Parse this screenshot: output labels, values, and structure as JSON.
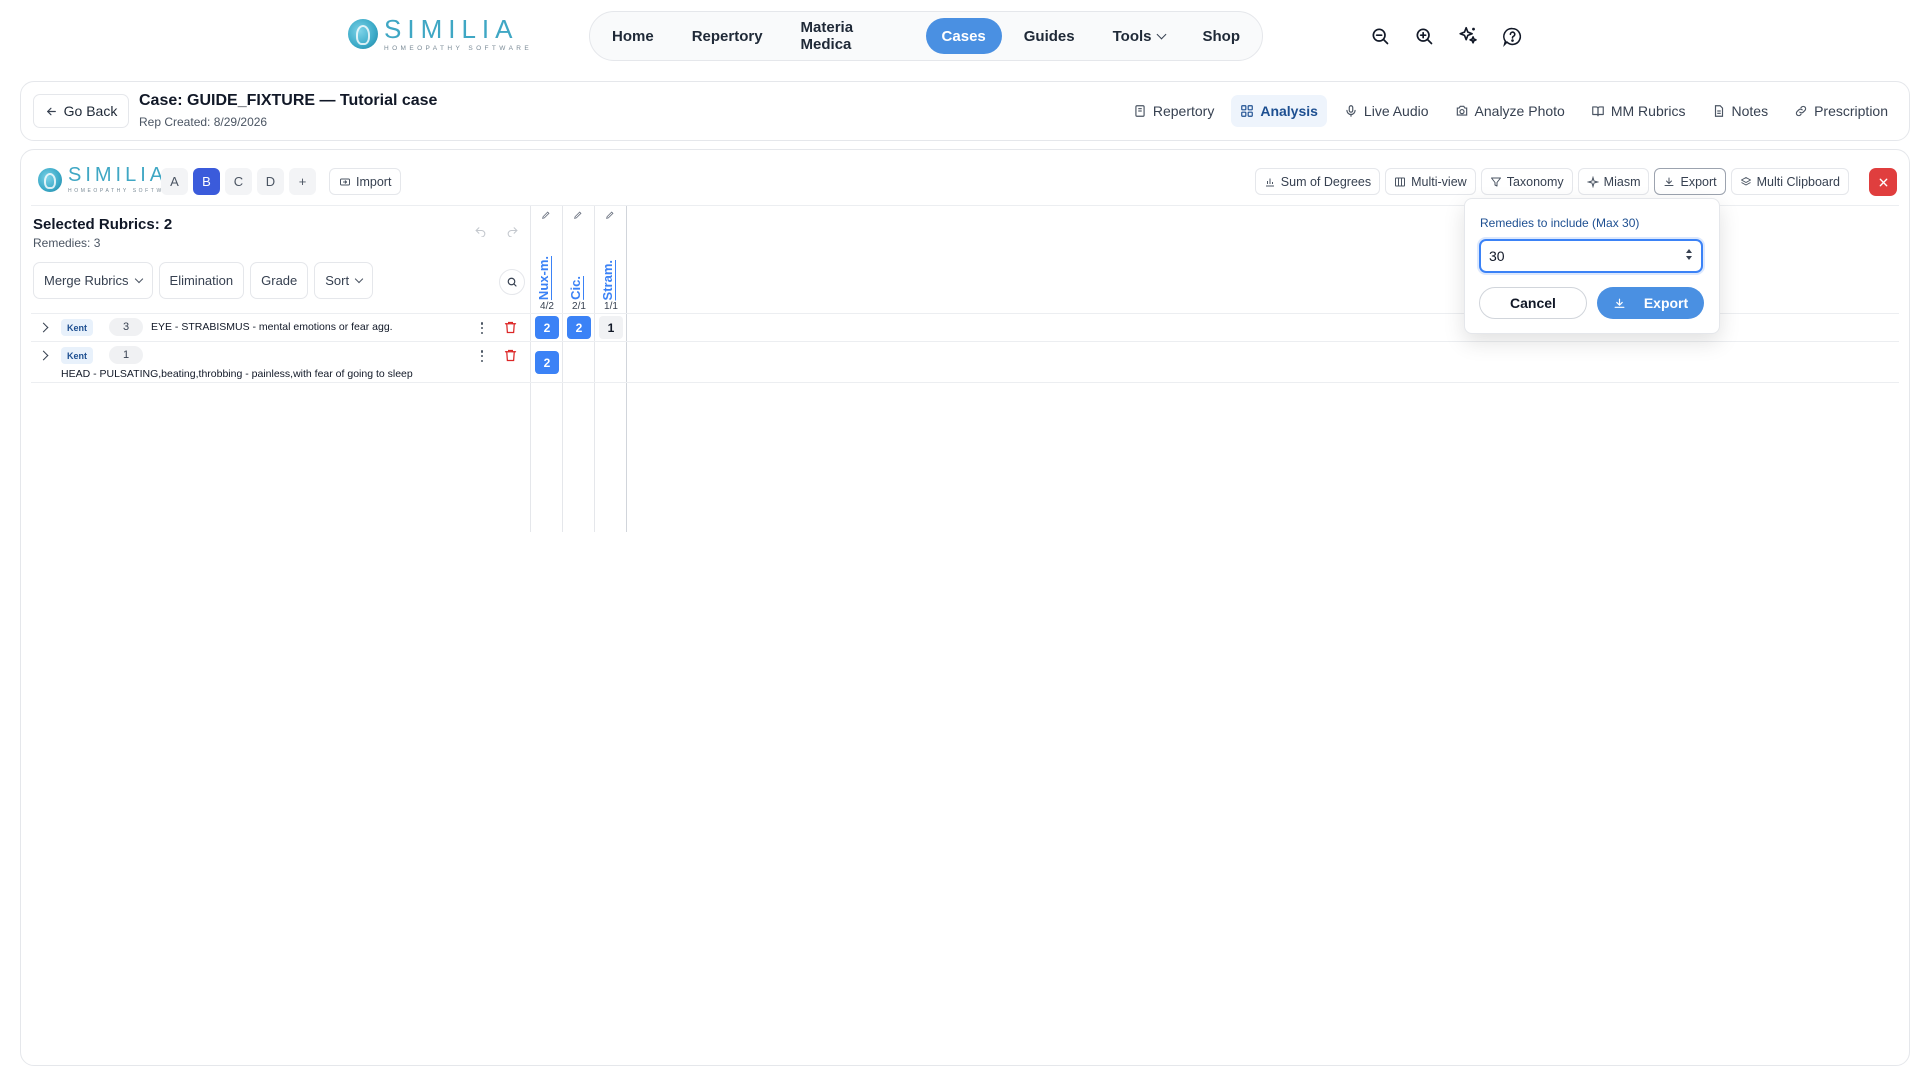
{
  "brand": {
    "name": "SIMILIA",
    "tagline": "HOMEOPATHY SOFTWARE"
  },
  "nav": {
    "items": [
      {
        "label": "Home"
      },
      {
        "label": "Repertory"
      },
      {
        "label": "Materia Medica"
      },
      {
        "label": "Cases",
        "active": true
      },
      {
        "label": "Guides"
      },
      {
        "label": "Tools",
        "dropdown": true
      },
      {
        "label": "Shop"
      }
    ],
    "icons": [
      "zoom-out-icon",
      "zoom-in-icon",
      "sparkles-icon",
      "help-icon"
    ]
  },
  "case": {
    "back_label": "Go Back",
    "title": "Case: GUIDE_FIXTURE — Tutorial case",
    "subtitle": "Rep Created: 8/29/2026",
    "tabs": [
      {
        "label": "Repertory",
        "icon": "book-icon"
      },
      {
        "label": "Analysis",
        "icon": "grid-icon",
        "active": true
      },
      {
        "label": "Live Audio",
        "icon": "mic-icon"
      },
      {
        "label": "Analyze Photo",
        "icon": "camera-icon"
      },
      {
        "label": "MM Rubrics",
        "icon": "open-book-icon"
      },
      {
        "label": "Notes",
        "icon": "note-icon"
      },
      {
        "label": "Prescription",
        "icon": "link-icon"
      }
    ]
  },
  "workspace": {
    "rep_tabs": [
      "A",
      "B",
      "C",
      "D",
      "+"
    ],
    "active_tab": "B",
    "import_label": "Import",
    "toolbar": [
      {
        "label": "Sum of Degrees",
        "icon": "bar-chart-icon"
      },
      {
        "label": "Multi-view",
        "icon": "columns-icon"
      },
      {
        "label": "Taxonomy",
        "icon": "filter-icon"
      },
      {
        "label": "Miasm",
        "icon": "sparkle-icon"
      },
      {
        "label": "Export",
        "icon": "download-icon"
      },
      {
        "label": "Multi Clipboard",
        "icon": "layers-icon"
      }
    ],
    "selected_rubrics": "Selected Rubrics: 2",
    "remedies_count": "Remedies: 3",
    "filters": {
      "merge": "Merge Rubrics",
      "elimination": "Elimination",
      "grade": "Grade",
      "sort": "Sort"
    },
    "remedies": [
      {
        "name": "Nux-m.",
        "ratio": "4/2"
      },
      {
        "name": "Cic.",
        "ratio": "2/1"
      },
      {
        "name": "Stram.",
        "ratio": "1/1"
      }
    ],
    "rubrics": [
      {
        "source": "Kent",
        "grade": "3",
        "text": "EYE - STRABISMUS - mental emotions or fear agg.",
        "cells": [
          "2",
          "2",
          "1"
        ]
      },
      {
        "source": "Kent",
        "grade": "1",
        "text": "HEAD - PULSATING,beating,throbbing - painless,with fear of going to sleep",
        "cells": [
          "2",
          "",
          ""
        ]
      }
    ]
  },
  "export_popover": {
    "label": "Remedies to include (Max 30)",
    "value": "30",
    "cancel": "Cancel",
    "confirm": "Export"
  },
  "colors": {
    "accent": "#4a90e2",
    "active_tab": "#3b5bdb",
    "danger": "#e03e3e",
    "brand": "#3fa7c4"
  }
}
